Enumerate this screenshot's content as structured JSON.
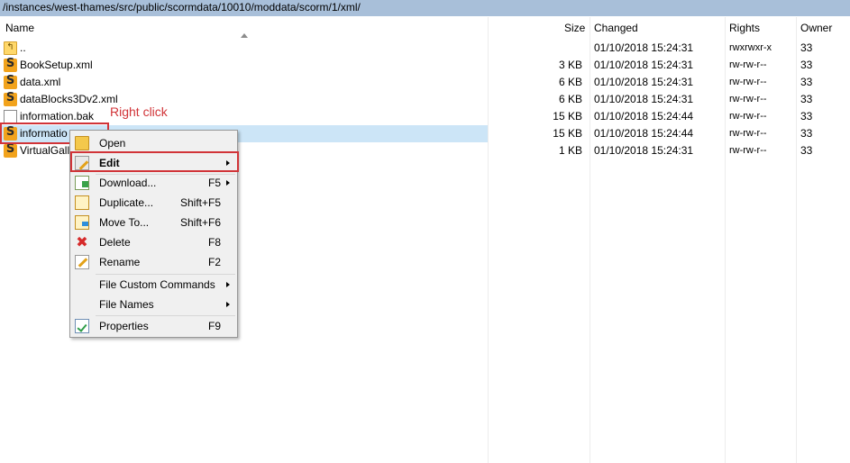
{
  "path": "/instances/west-thames/src/public/scormdata/10010/moddata/scorm/1/xml/",
  "columns": {
    "name": "Name",
    "size": "Size",
    "changed": "Changed",
    "rights": "Rights",
    "owner": "Owner"
  },
  "files": [
    {
      "name": "..",
      "icon": "parent-folder-icon",
      "size": "",
      "changed": "01/10/2018 15:24:31",
      "rights": "rwxrwxr-x",
      "owner": "33"
    },
    {
      "name": "BookSetup.xml",
      "icon": "sublime-file-icon",
      "size": "3 KB",
      "changed": "01/10/2018 15:24:31",
      "rights": "rw-rw-r--",
      "owner": "33"
    },
    {
      "name": "data.xml",
      "icon": "sublime-file-icon",
      "size": "6 KB",
      "changed": "01/10/2018 15:24:31",
      "rights": "rw-rw-r--",
      "owner": "33"
    },
    {
      "name": "dataBlocks3Dv2.xml",
      "icon": "sublime-file-icon",
      "size": "6 KB",
      "changed": "01/10/2018 15:24:31",
      "rights": "rw-rw-r--",
      "owner": "33"
    },
    {
      "name": "information.bak",
      "icon": "document-icon",
      "size": "15 KB",
      "changed": "01/10/2018 15:24:44",
      "rights": "rw-rw-r--",
      "owner": "33"
    },
    {
      "name": "informatio",
      "icon": "sublime-file-icon",
      "size": "15 KB",
      "changed": "01/10/2018 15:24:44",
      "rights": "rw-rw-r--",
      "owner": "33",
      "selected": true
    },
    {
      "name": "VirtualGall",
      "icon": "sublime-file-icon",
      "size": "1 KB",
      "changed": "01/10/2018 15:24:31",
      "rights": "rw-rw-r--",
      "owner": "33"
    }
  ],
  "annotation": {
    "label": "Right click",
    "color": "#d13438"
  },
  "context_menu": {
    "open": {
      "label": "Open",
      "icon": "open-folder-icon"
    },
    "edit": {
      "label": "Edit",
      "icon": "edit-icon"
    },
    "download": {
      "label": "Download...",
      "shortcut": "F5",
      "icon": "download-icon"
    },
    "duplicate": {
      "label": "Duplicate...",
      "shortcut": "Shift+F5",
      "icon": "duplicate-icon"
    },
    "move_to": {
      "label": "Move To...",
      "shortcut": "Shift+F6",
      "icon": "move-icon"
    },
    "delete": {
      "label": "Delete",
      "shortcut": "F8",
      "icon": "delete-icon"
    },
    "rename": {
      "label": "Rename",
      "shortcut": "F2",
      "icon": "rename-icon"
    },
    "custom_commands": {
      "label": "File Custom Commands"
    },
    "file_names": {
      "label": "File Names"
    },
    "properties": {
      "label": "Properties",
      "shortcut": "F9",
      "icon": "properties-icon"
    }
  },
  "colors": {
    "path_bar": "#a8bfd9",
    "selection": "#cce5f7",
    "menu_bg": "#f0f0f0"
  }
}
